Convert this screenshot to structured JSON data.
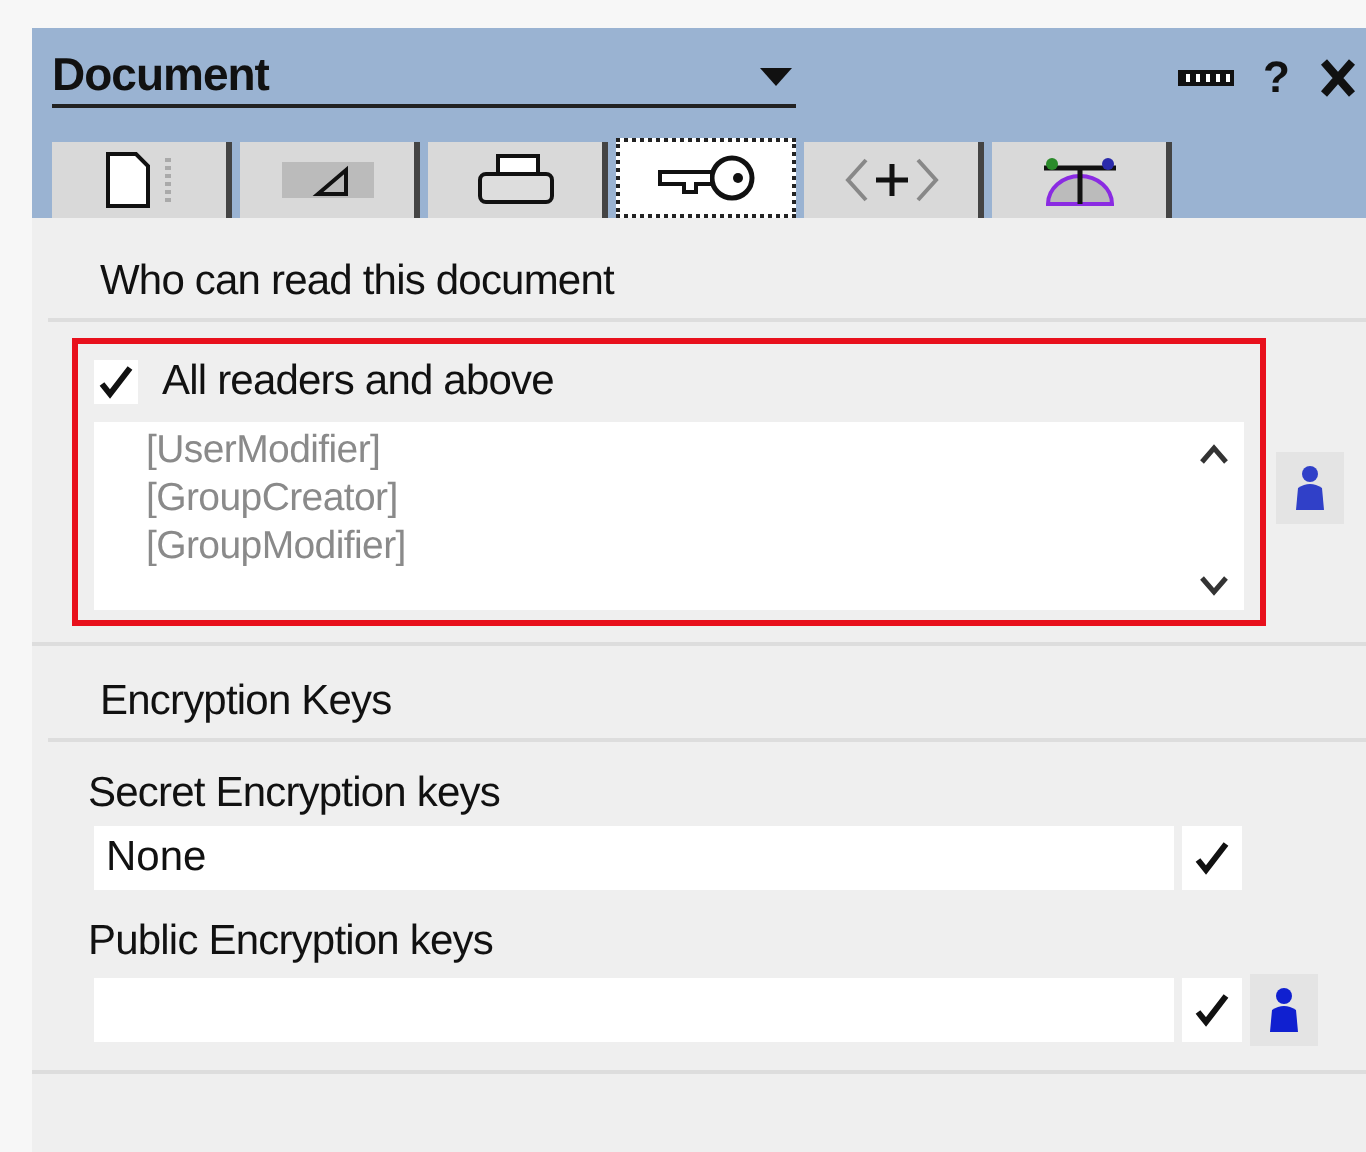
{
  "window": {
    "title": "Document",
    "help": "?"
  },
  "tabs": [
    {
      "kind": "document",
      "selected": false
    },
    {
      "kind": "ruler",
      "selected": false
    },
    {
      "kind": "printer",
      "selected": false
    },
    {
      "kind": "key",
      "selected": true
    },
    {
      "kind": "code",
      "selected": false
    },
    {
      "kind": "weathervane",
      "selected": false
    }
  ],
  "readers": {
    "title": "Who can read this document",
    "highlighted": true,
    "all_readers": {
      "label": "All readers and above",
      "checked": true
    },
    "entries": [
      "[UserModifier]",
      "[GroupCreator]",
      "[GroupModifier]"
    ]
  },
  "encryption": {
    "title": "Encryption Keys",
    "fields": [
      {
        "label": "Secret Encryption keys",
        "value": "None",
        "people_button": false
      },
      {
        "label": "Public Encryption keys",
        "people_button": true
      }
    ]
  }
}
